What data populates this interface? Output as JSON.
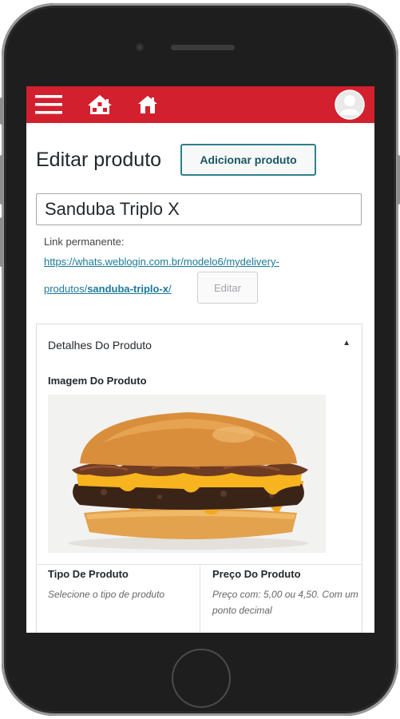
{
  "topbar": {
    "color": "#d3202f",
    "icons": [
      "menu-icon",
      "homes-icon",
      "home-icon",
      "avatar-icon"
    ]
  },
  "page": {
    "title": "Editar produto",
    "add_button": "Adicionar produto"
  },
  "product": {
    "name": "Sanduba Triplo X"
  },
  "permalink": {
    "label": "Link permanente:",
    "line1": "https://whats.weblogin.com.br/modelo6/mydelivery-",
    "line2_prefix": "produtos/",
    "line2_slug": "sanduba-triplo-x",
    "line2_suffix": "/",
    "edit_button": "Editar"
  },
  "details": {
    "heading": "Detalhes Do Produto",
    "image_label": "Imagem Do Produto",
    "type_title": "Tipo De Produto",
    "type_desc": "Selecione o tipo de produto",
    "price_title": "Preço Do Produto",
    "price_desc": "Preço com: 5,00 ou 4,50. Com um ponto decimal"
  }
}
